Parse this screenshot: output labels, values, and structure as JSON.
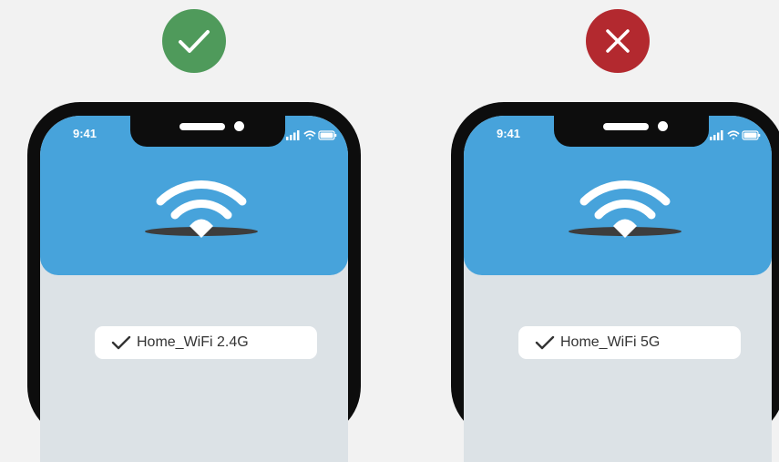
{
  "colors": {
    "background": "#f2f2f2",
    "correct_badge": "#4f9a5b",
    "wrong_badge": "#b3292f",
    "screen_header": "#47a3db",
    "screen_body": "#dce2e6",
    "phone_frame": "#0d0d0d"
  },
  "panels": [
    {
      "verdict_icon": "checkmark-icon",
      "verdict_color": "#4f9a5b",
      "status_bar": {
        "time": "9:41"
      },
      "network": {
        "check_icon": "checkmark-icon",
        "label": "Home_WiFi 2.4G"
      }
    },
    {
      "verdict_icon": "close-icon",
      "verdict_color": "#b3292f",
      "status_bar": {
        "time": "9:41"
      },
      "network": {
        "check_icon": "checkmark-icon",
        "label": "Home_WiFi 5G"
      }
    }
  ]
}
